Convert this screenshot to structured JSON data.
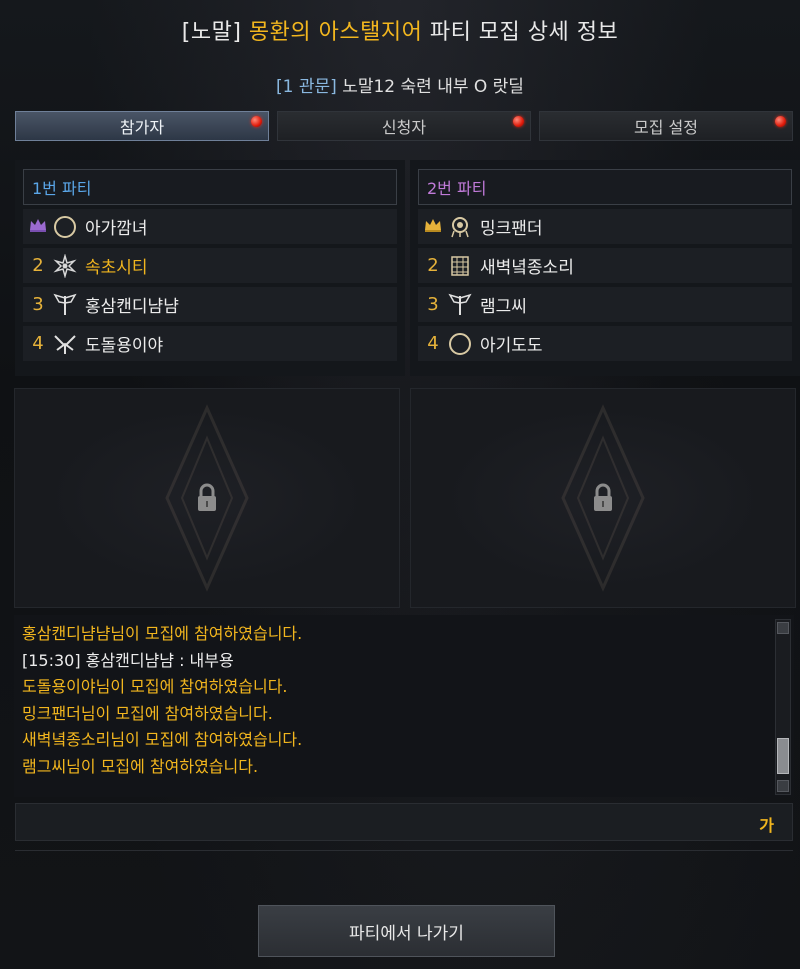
{
  "header": {
    "title_bracket": "[노말]",
    "title_raid": "몽환의 아스탤지어",
    "title_rest": "파티 모집 상세 정보",
    "subtitle_gate": "[1 관문]",
    "subtitle_text": "노말12 숙련 내부 O 랏딜"
  },
  "tabs": [
    {
      "label": "참가자",
      "active": true
    },
    {
      "label": "신청자",
      "active": false
    },
    {
      "label": "모집 설정",
      "active": false
    }
  ],
  "party1": {
    "name": "1번 파티",
    "members": [
      {
        "slot": "leader",
        "icon": "moon-class-icon",
        "name": "아가깜녀"
      },
      {
        "slot": "2",
        "icon": "spiked-class-icon",
        "name": "속초시티",
        "highlight": true
      },
      {
        "slot": "3",
        "icon": "winged-blade-class-icon",
        "name": "홍삼캔디냠냠"
      },
      {
        "slot": "4",
        "icon": "crossed-wings-class-icon",
        "name": "도돌용이야"
      }
    ]
  },
  "party2": {
    "name": "2번 파티",
    "members": [
      {
        "slot": "leader",
        "icon": "ornate-class-icon",
        "name": "밍크팬더"
      },
      {
        "slot": "2",
        "icon": "lattice-class-icon",
        "name": "새벽녘종소리"
      },
      {
        "slot": "3",
        "icon": "winged-blade-class-icon",
        "name": "램그씨"
      },
      {
        "slot": "4",
        "icon": "moon-class-icon",
        "name": "아기도도"
      }
    ]
  },
  "chat_log": [
    {
      "text": "홍삼캔디냠냠님이 모집에 참여하였습니다.",
      "type": "system"
    },
    {
      "text": "[15:30] 홍삼캔디냠냠 : 내부용",
      "type": "chat"
    },
    {
      "text": "도돌용이야님이 모집에 참여하였습니다.",
      "type": "system"
    },
    {
      "text": "밍크팬더님이 모집에 참여하였습니다.",
      "type": "system"
    },
    {
      "text": "새벽녘종소리님이 모집에 참여하였습니다.",
      "type": "system"
    },
    {
      "text": "램그씨님이 모집에 참여하였습니다.",
      "type": "system"
    }
  ],
  "chat_input": {
    "mode_label": "가"
  },
  "footer": {
    "leave_label": "파티에서 나가기"
  },
  "colors": {
    "accent_gold": "#f2b61e",
    "party1_blue": "#5aa6e8",
    "party2_purple": "#c07ad8",
    "notify_red": "#e01a0a"
  }
}
